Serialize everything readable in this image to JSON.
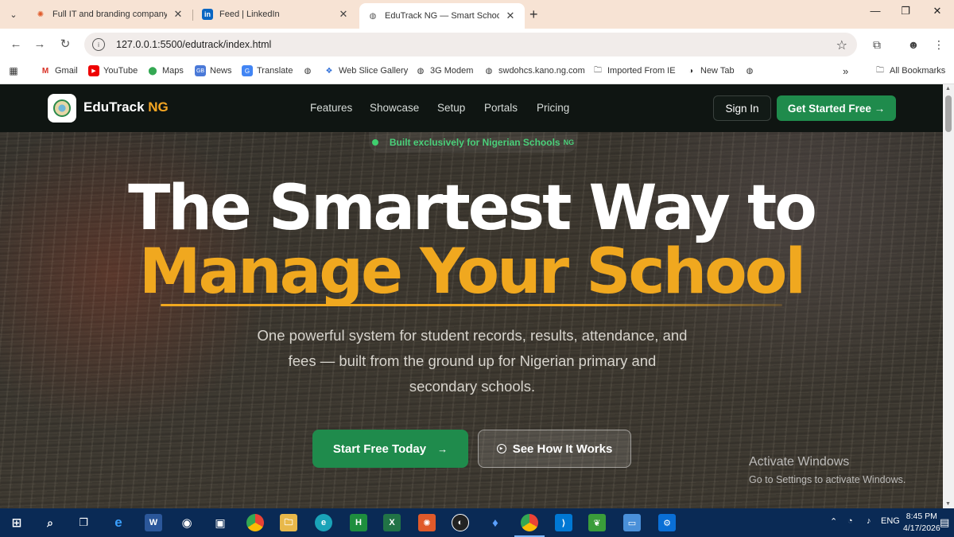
{
  "browser": {
    "tabs": [
      {
        "title": "Full IT and branding company w",
        "icon": "spark-icon",
        "color": "#e05a2a"
      },
      {
        "title": "Feed | LinkedIn",
        "icon": "linkedin-icon",
        "color": "#0a66c2"
      },
      {
        "title": "EduTrack NG — Smart School M",
        "icon": "globe-icon",
        "color": "#555555"
      }
    ],
    "url": "127.0.0.1:5500/edutrack/index.html",
    "bookmarks": [
      "Gmail",
      "YouTube",
      "Maps",
      "News",
      "Translate",
      "",
      "Web Slice Gallery",
      "3G Modem",
      "swdohcs.kano.ng.com",
      "Imported From IE",
      "New Tab",
      ""
    ],
    "all_bookmarks": "All Bookmarks"
  },
  "site": {
    "brand_main": "EduTrack",
    "brand_accent": "NG",
    "nav": [
      "Features",
      "Showcase",
      "Setup",
      "Portals",
      "Pricing"
    ],
    "signin": "Sign In",
    "get_started": "Get Started Free →",
    "badge": "Built exclusively for Nigerian Schools",
    "badge_suffix": "NG",
    "headline_line1": "The Smartest Way to",
    "headline_line2": "Manage Your School",
    "subtitle": "One powerful system for student records, results, attendance, and fees — built from the ground up for Nigerian primary and secondary schools.",
    "cta_primary": "Start Free Today",
    "cta_primary_arrow": "→",
    "cta_secondary": "See How It Works",
    "colors": {
      "green": "#1f8b4c",
      "gold": "#f0a81f",
      "dark": "#0f1512"
    }
  },
  "watermark": {
    "line1": "Activate Windows",
    "line2": "Go to Settings to activate Windows."
  },
  "taskbar": {
    "lang": "ENG",
    "time": "8:45 PM",
    "date": "4/17/2026"
  }
}
